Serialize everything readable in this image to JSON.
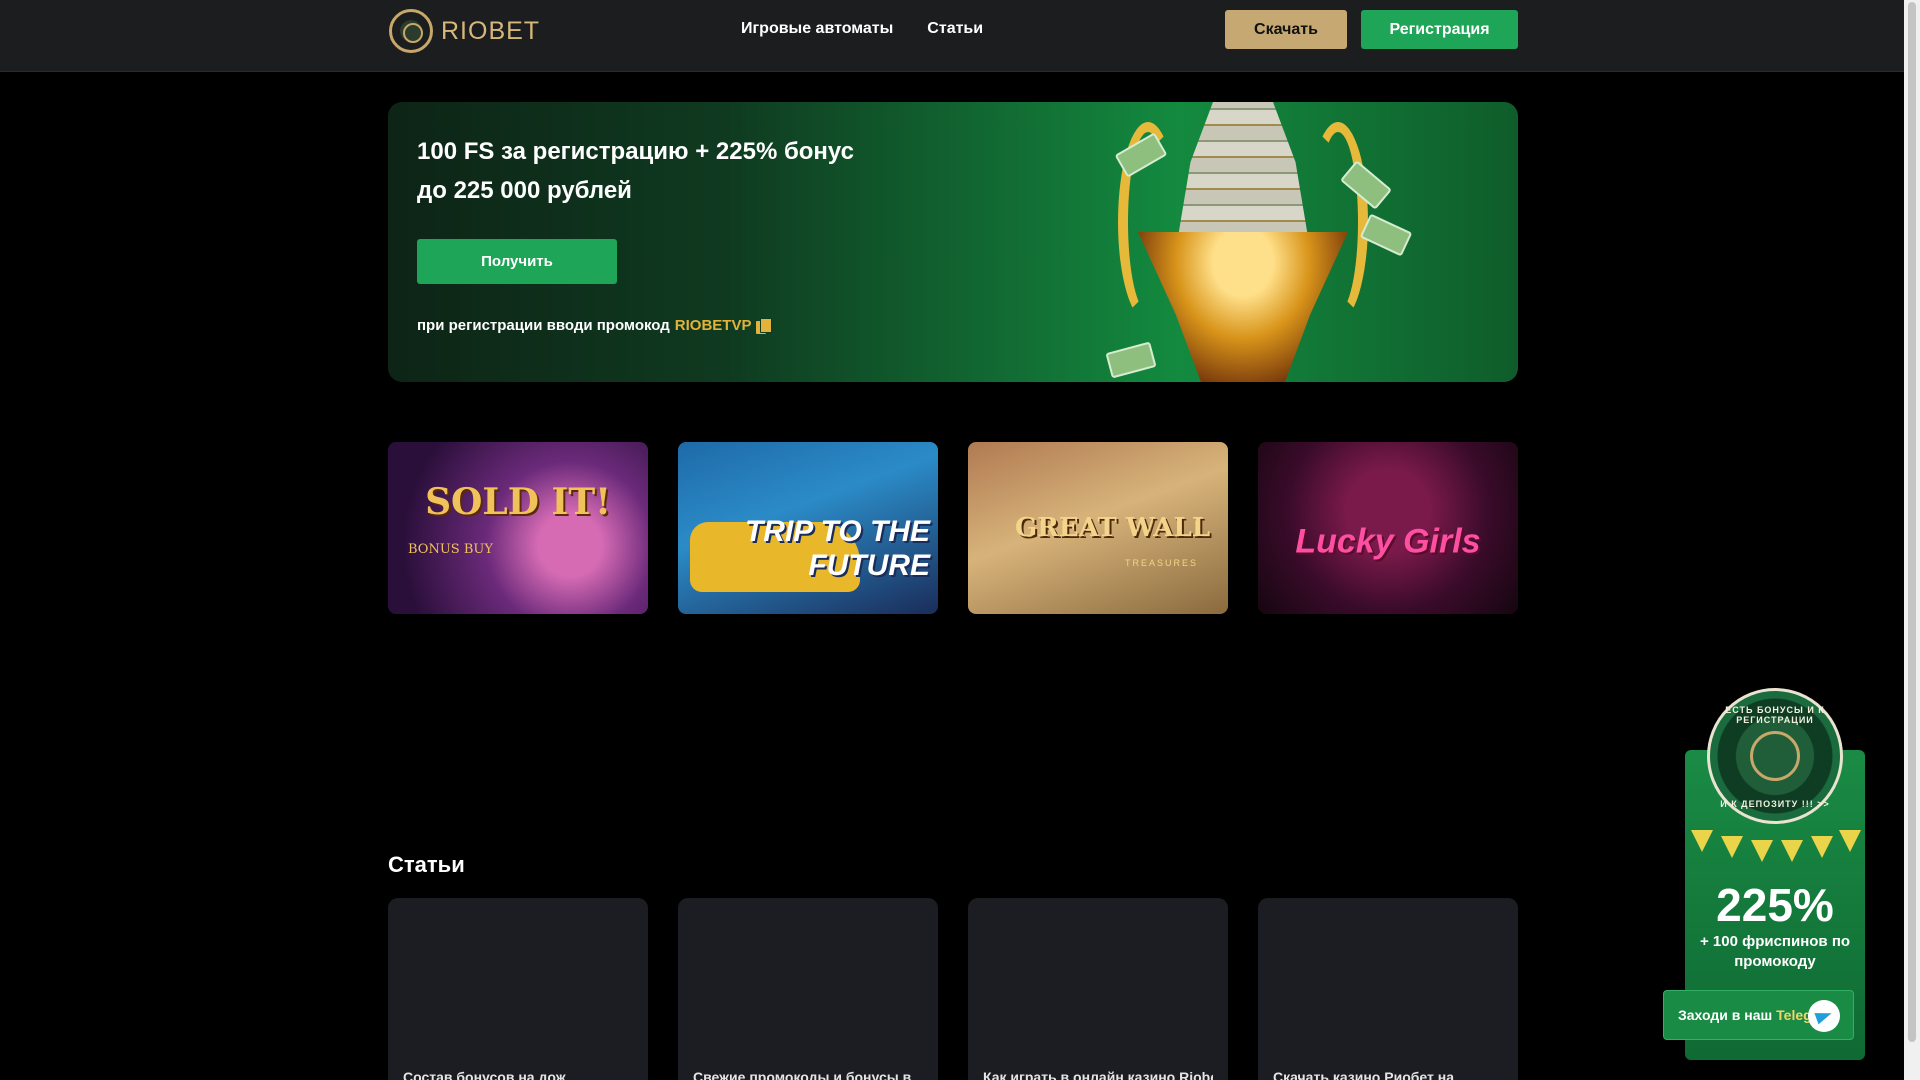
{
  "header": {
    "logo_text": "RIOBET",
    "nav": [
      {
        "label": "Игровые автоматы"
      },
      {
        "label": "Статьи"
      }
    ],
    "download_label": "Скачать",
    "register_label": "Регистрация"
  },
  "banner": {
    "title": "100 FS за регистрацию + 225% бонус до 225 000 рублей",
    "button_label": "Получить",
    "promo_text": "при регистрации вводи промокод",
    "promo_code": "RIOBETVP"
  },
  "games": [
    {
      "title": "SOLD IT!",
      "subtitle": "BONUS BUY"
    },
    {
      "title": "TRIP TO THE FUTURE"
    },
    {
      "title": "GREAT WALL",
      "subtitle": "TREASURES"
    },
    {
      "title": "Lucky Girls"
    }
  ],
  "articles": {
    "heading": "Статьи",
    "cards": [
      {
        "title": "Состав бонусов на дож"
      },
      {
        "title": "Свежие промокоды и бонусы в"
      },
      {
        "title": "Как играть в онлайн казино Riobet"
      },
      {
        "title": "Скачать казино Риобет на"
      }
    ]
  },
  "side_promo": {
    "badge_text_top": "ЕСТЬ БОНУСЫ И К РЕГИСТРАЦИИ",
    "badge_text_bottom": "И К ДЕПОЗИТУ !!! >>",
    "percent": "225%",
    "description": "+ 100 фриспинов по промокоду",
    "telegram_prefix": "Заходи в наш",
    "telegram_word": "Telegram"
  },
  "colors": {
    "header_bg": "#1c1d1f",
    "accent_green": "#1ea557",
    "accent_gold": "#c5a872",
    "promo_code": "#e2b23a"
  }
}
